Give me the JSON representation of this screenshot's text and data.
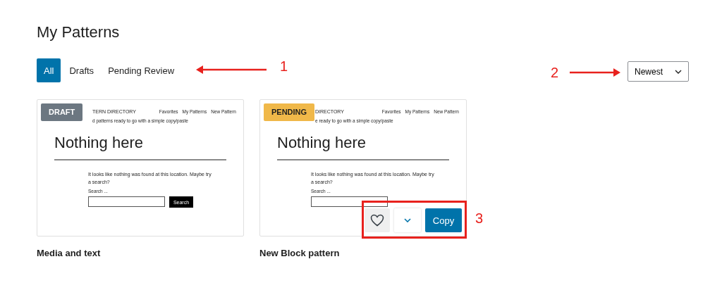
{
  "page_title": "My Patterns",
  "tabs": [
    {
      "label": "All",
      "selected": true
    },
    {
      "label": "Drafts",
      "selected": false
    },
    {
      "label": "Pending Review",
      "selected": false
    }
  ],
  "sort": {
    "value": "Newest"
  },
  "patterns": [
    {
      "title": "Media and text",
      "status": {
        "kind": "draft",
        "label": "DRAFT"
      },
      "preview": {
        "site_title": "TERN DIRECTORY",
        "tagline": "d patterns ready to go with a simple copy/paste",
        "nav": [
          "Favorites",
          "My Patterns",
          "New Pattern"
        ],
        "heading": "Nothing here",
        "message": "It looks like nothing was found at this location. Maybe try a search?",
        "search_label": "Search ...",
        "search_button": "Search"
      }
    },
    {
      "title": "New Block pattern",
      "status": {
        "kind": "pending",
        "label": "PENDING"
      },
      "preview": {
        "site_title": "DIRECTORY",
        "tagline": "e ready to go with a simple copy/paste",
        "nav": [
          "Favorites",
          "My Patterns",
          "New Pattern"
        ],
        "heading": "Nothing here",
        "message": "It looks like nothing was found at this location. Maybe try a search?",
        "search_label": "Search ..."
      },
      "actions": {
        "favorited": false,
        "copy_label": "Copy"
      }
    }
  ],
  "annotations": [
    {
      "kind": "arrow_left",
      "label": "1"
    },
    {
      "kind": "arrow_right",
      "label": "2"
    },
    {
      "kind": "box",
      "label": "3"
    }
  ]
}
